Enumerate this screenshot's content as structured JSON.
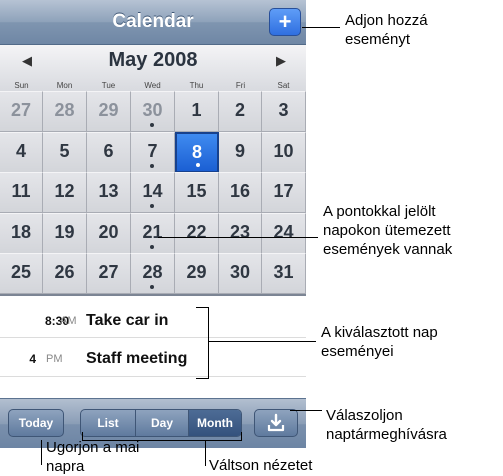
{
  "nav": {
    "title": "Calendar",
    "add_symbol": "+"
  },
  "month": {
    "title": "May 2008",
    "prev_symbol": "◀",
    "next_symbol": "▶",
    "weekdays": [
      "Sun",
      "Mon",
      "Tue",
      "Wed",
      "Thu",
      "Fri",
      "Sat"
    ]
  },
  "days": [
    [
      "27",
      "28",
      "29",
      "30",
      "1",
      "2",
      "3"
    ],
    [
      "4",
      "5",
      "6",
      "7",
      "8",
      "9",
      "10"
    ],
    [
      "11",
      "12",
      "13",
      "14",
      "15",
      "16",
      "17"
    ],
    [
      "18",
      "19",
      "20",
      "21",
      "22",
      "23",
      "24"
    ],
    [
      "25",
      "26",
      "27",
      "28",
      "29",
      "30",
      "31"
    ]
  ],
  "events": [
    {
      "time": "8:30",
      "ampm": "AM",
      "title": "Take car in"
    },
    {
      "time": "4",
      "ampm": "PM",
      "title": "Staff meeting"
    }
  ],
  "toolbar": {
    "today": "Today",
    "list": "List",
    "day": "Day",
    "month": "Month",
    "sync_icon": "download-icon"
  },
  "callouts": {
    "add": "Adjon hozzá\neseményt",
    "dots": "A pontokkal jelölt\nnapokon ütemezett\nesemények vannak",
    "selected": "A kiválasztott nap\neseményei",
    "reply": "Válaszoljon\nnaptármeghívásra",
    "today": "Ugorjon a mai\nnapra",
    "view": "Váltson nézetet"
  }
}
